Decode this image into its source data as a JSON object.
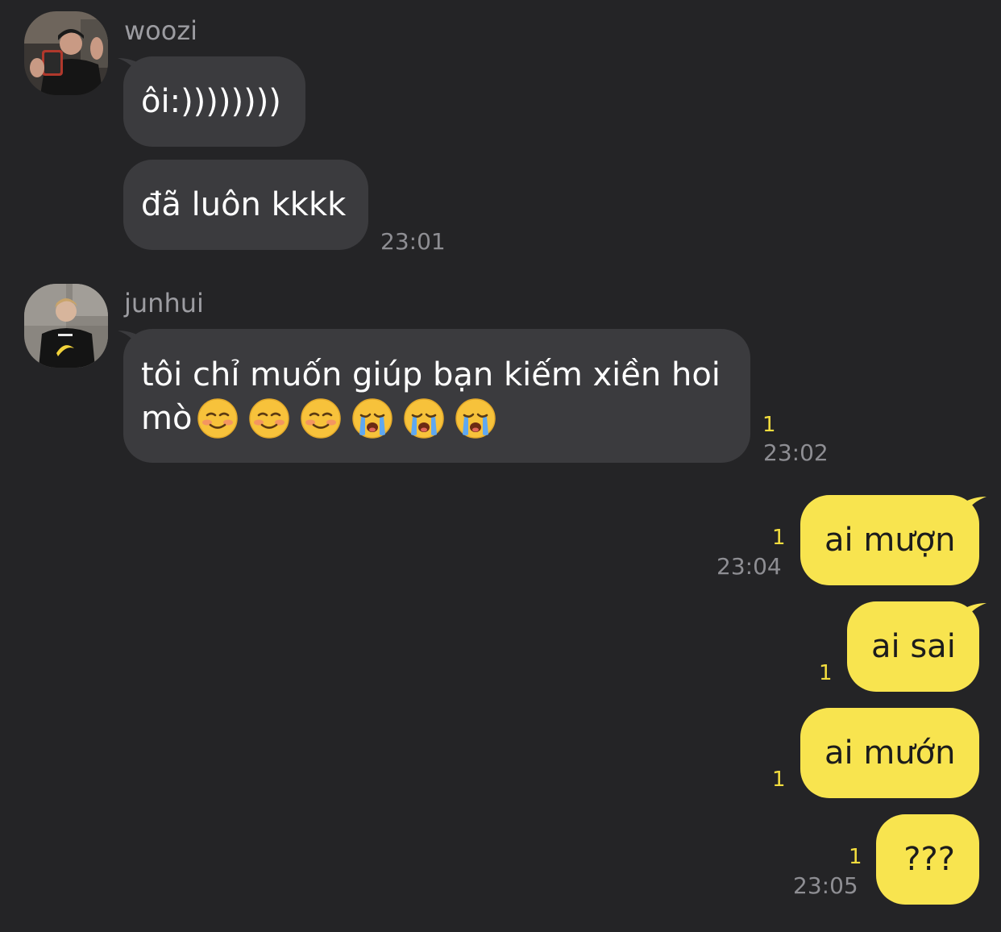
{
  "colors": {
    "background": "#242426",
    "incoming_bubble": "#3b3b3e",
    "outgoing_bubble": "#f8e44f",
    "unread_count": "#f3dd3e",
    "meta_text": "#8e8e93"
  },
  "groups": [
    {
      "sender": "woozi",
      "avatar_icon": "profile-photo-mirror-selfie-icon",
      "messages": [
        {
          "text": "ôi:))))))))"
        },
        {
          "text": "đã luôn kkkk",
          "time": "23:01"
        }
      ]
    },
    {
      "sender": "junhui",
      "avatar_icon": "profile-photo-banana-shirt-icon",
      "messages": [
        {
          "line1": "tôi chỉ muốn giúp bạn kiếm xiền hoi",
          "line2": "mò",
          "emojis": [
            "smiling-face-icon",
            "smiling-face-icon",
            "smiling-face-icon",
            "crying-face-icon",
            "crying-face-icon",
            "crying-face-icon"
          ],
          "unread": "1",
          "time": "23:02"
        }
      ]
    }
  ],
  "outgoing": [
    {
      "text": "ai mượn",
      "unread": "1",
      "time": "23:04"
    },
    {
      "text": "ai sai",
      "unread": "1"
    },
    {
      "text": "ai mướn",
      "unread": "1"
    },
    {
      "text": "???",
      "unread": "1",
      "time": "23:05"
    }
  ]
}
